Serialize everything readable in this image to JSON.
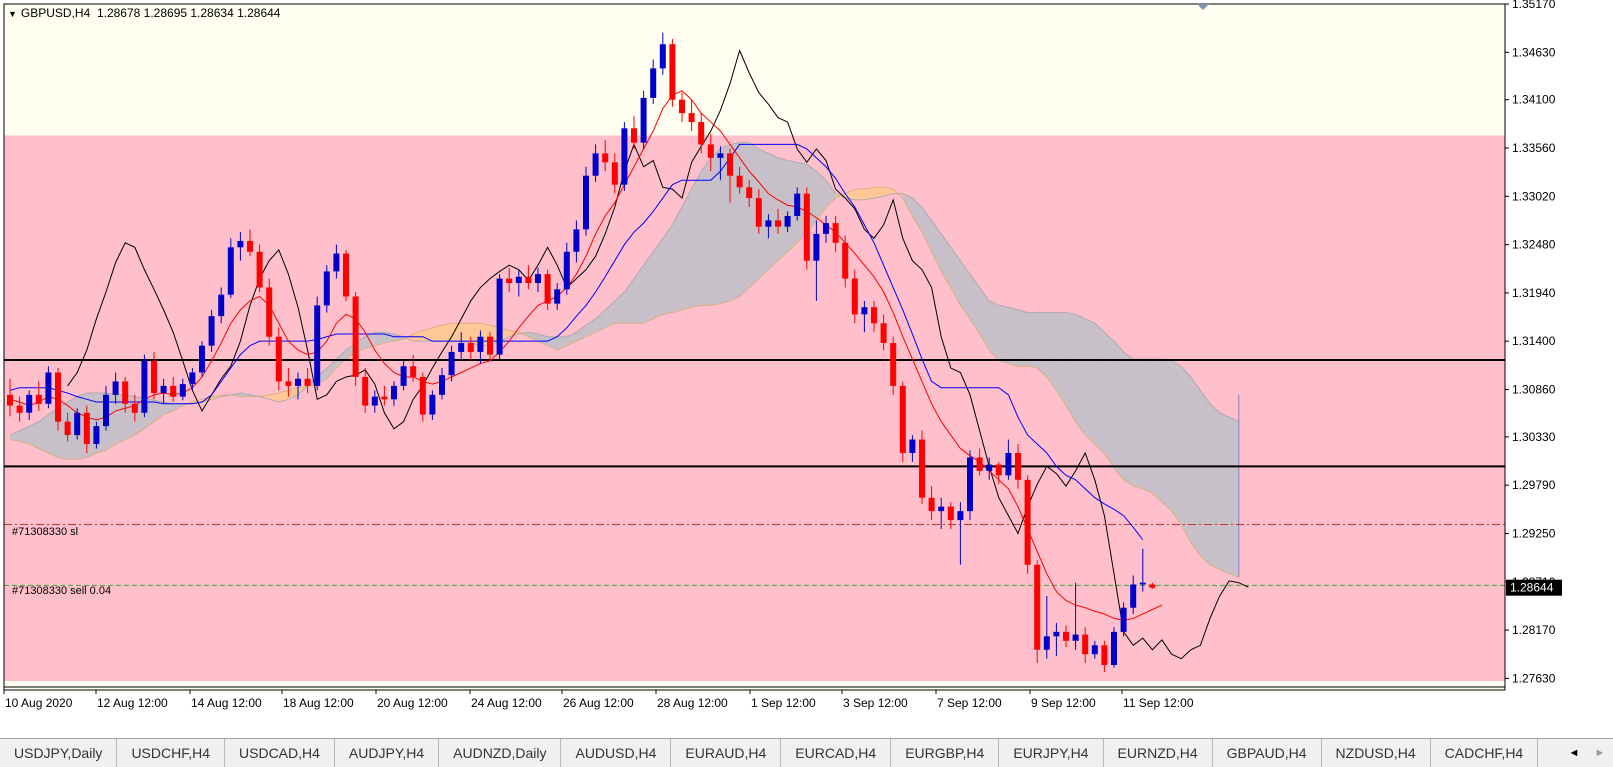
{
  "header": {
    "symbol": "GBPUSD,H4",
    "ohlc": "1.28678 1.28695 1.28634 1.28644"
  },
  "orders": {
    "sl_label": "#71308330 sl",
    "sell_label": "#71308330 sell 0.04"
  },
  "price_tag": "1.28644",
  "colors": {
    "background_top": "#fffef0",
    "background_zone": "#ffc0cb",
    "bull_candle": "#0000cd",
    "bear_candle": "#ff0000",
    "tenkan": "#ff0000",
    "kijun": "#0000ff",
    "chikou": "#000000",
    "kumo_bear": "#c8c0c8",
    "kumo_bull": "#ffc896"
  },
  "chart_data": {
    "type": "candlestick",
    "symbol": "GBPUSD",
    "timeframe": "H4",
    "ylim": [
      1.275,
      1.3517
    ],
    "y_ticks": [
      "1.35170",
      "1.34630",
      "1.34100",
      "1.33560",
      "1.33020",
      "1.32480",
      "1.31940",
      "1.31400",
      "1.30860",
      "1.30330",
      "1.29790",
      "1.29250",
      "1.28710",
      "1.28170",
      "1.27630"
    ],
    "x_ticks": [
      "10 Aug 2020",
      "12 Aug 12:00",
      "14 Aug 12:00",
      "18 Aug 12:00",
      "20 Aug 12:00",
      "24 Aug 12:00",
      "26 Aug 12:00",
      "28 Aug 12:00",
      "1 Sep 12:00",
      "3 Sep 12:00",
      "7 Sep 12:00",
      "9 Sep 12:00",
      "11 Sep 12:00"
    ],
    "zone": {
      "low": 1.276,
      "high": 1.337
    },
    "horizontal_lines": [
      {
        "name": "level-upper",
        "price": 1.3119,
        "style": "solid"
      },
      {
        "name": "level-lower",
        "price": 1.3,
        "style": "solid"
      },
      {
        "name": "stop-loss",
        "price": 1.2935,
        "style": "dash-dot"
      },
      {
        "name": "sell-entry",
        "price": 1.2867,
        "style": "dashed"
      }
    ],
    "close_price": 1.28644,
    "candles": [
      [
        1.308,
        1.3098,
        1.3056,
        1.3068
      ],
      [
        1.3068,
        1.3078,
        1.305,
        1.306
      ],
      [
        1.306,
        1.3085,
        1.3052,
        1.308
      ],
      [
        1.308,
        1.3095,
        1.3062,
        1.307
      ],
      [
        1.307,
        1.3112,
        1.3065,
        1.3105
      ],
      [
        1.3105,
        1.311,
        1.304,
        1.305
      ],
      [
        1.305,
        1.306,
        1.3028,
        1.3035
      ],
      [
        1.3035,
        1.3065,
        1.303,
        1.306
      ],
      [
        1.306,
        1.3068,
        1.3015,
        1.3025
      ],
      [
        1.3025,
        1.305,
        1.302,
        1.3045
      ],
      [
        1.3045,
        1.309,
        1.304,
        1.308
      ],
      [
        1.308,
        1.3105,
        1.307,
        1.3095
      ],
      [
        1.3095,
        1.31,
        1.306,
        1.307
      ],
      [
        1.307,
        1.308,
        1.305,
        1.306
      ],
      [
        1.306,
        1.3125,
        1.3055,
        1.3118
      ],
      [
        1.3118,
        1.3128,
        1.3075,
        1.3082
      ],
      [
        1.3082,
        1.3098,
        1.307,
        1.309
      ],
      [
        1.309,
        1.31,
        1.3072,
        1.3078
      ],
      [
        1.3078,
        1.3098,
        1.3074,
        1.3092
      ],
      [
        1.3092,
        1.311,
        1.3085,
        1.3105
      ],
      [
        1.3105,
        1.314,
        1.31,
        1.3135
      ],
      [
        1.3135,
        1.3175,
        1.3128,
        1.3168
      ],
      [
        1.3168,
        1.32,
        1.316,
        1.3192
      ],
      [
        1.3192,
        1.3255,
        1.3188,
        1.3245
      ],
      [
        1.3245,
        1.3262,
        1.323,
        1.3252
      ],
      [
        1.3252,
        1.3265,
        1.3235,
        1.324
      ],
      [
        1.324,
        1.3248,
        1.3195,
        1.32
      ],
      [
        1.32,
        1.321,
        1.3135,
        1.3145
      ],
      [
        1.3145,
        1.3155,
        1.3085,
        1.3095
      ],
      [
        1.3095,
        1.311,
        1.3078,
        1.309
      ],
      [
        1.309,
        1.3105,
        1.3075,
        1.3098
      ],
      [
        1.3098,
        1.311,
        1.3082,
        1.309
      ],
      [
        1.309,
        1.319,
        1.3085,
        1.318
      ],
      [
        1.318,
        1.3225,
        1.3172,
        1.3218
      ],
      [
        1.3218,
        1.3248,
        1.321,
        1.3238
      ],
      [
        1.3238,
        1.3242,
        1.3185,
        1.319
      ],
      [
        1.319,
        1.3195,
        1.309,
        1.31
      ],
      [
        1.31,
        1.311,
        1.306,
        1.3068
      ],
      [
        1.3068,
        1.3085,
        1.306,
        1.3078
      ],
      [
        1.3078,
        1.309,
        1.3068,
        1.3075
      ],
      [
        1.3075,
        1.3095,
        1.3068,
        1.309
      ],
      [
        1.309,
        1.312,
        1.3085,
        1.3112
      ],
      [
        1.3112,
        1.3125,
        1.3095,
        1.31
      ],
      [
        1.31,
        1.3105,
        1.305,
        1.3058
      ],
      [
        1.3058,
        1.3085,
        1.3052,
        1.308
      ],
      [
        1.308,
        1.311,
        1.3075,
        1.3102
      ],
      [
        1.3102,
        1.3135,
        1.3095,
        1.3128
      ],
      [
        1.3128,
        1.315,
        1.3118,
        1.3138
      ],
      [
        1.3138,
        1.3145,
        1.312,
        1.3128
      ],
      [
        1.3128,
        1.3152,
        1.3115,
        1.3145
      ],
      [
        1.3145,
        1.315,
        1.3118,
        1.3125
      ],
      [
        1.3125,
        1.3215,
        1.312,
        1.321
      ],
      [
        1.321,
        1.3222,
        1.3195,
        1.3205
      ],
      [
        1.3205,
        1.322,
        1.319,
        1.3212
      ],
      [
        1.3212,
        1.3225,
        1.3198,
        1.3205
      ],
      [
        1.3205,
        1.3222,
        1.3195,
        1.3215
      ],
      [
        1.3215,
        1.322,
        1.3175,
        1.3182
      ],
      [
        1.3182,
        1.3205,
        1.3175,
        1.3198
      ],
      [
        1.3198,
        1.325,
        1.3192,
        1.324
      ],
      [
        1.324,
        1.3275,
        1.3228,
        1.3265
      ],
      [
        1.3265,
        1.3335,
        1.3258,
        1.3325
      ],
      [
        1.3325,
        1.336,
        1.3318,
        1.335
      ],
      [
        1.335,
        1.3365,
        1.333,
        1.334
      ],
      [
        1.334,
        1.335,
        1.3305,
        1.3315
      ],
      [
        1.3315,
        1.3385,
        1.3308,
        1.3378
      ],
      [
        1.3378,
        1.3392,
        1.3355,
        1.3362
      ],
      [
        1.3362,
        1.342,
        1.3355,
        1.3412
      ],
      [
        1.3412,
        1.3455,
        1.3405,
        1.3445
      ],
      [
        1.3445,
        1.3485,
        1.3438,
        1.3472
      ],
      [
        1.3472,
        1.3478,
        1.3402,
        1.341
      ],
      [
        1.341,
        1.3418,
        1.3385,
        1.3395
      ],
      [
        1.3395,
        1.341,
        1.3375,
        1.3385
      ],
      [
        1.3385,
        1.3395,
        1.335,
        1.336
      ],
      [
        1.336,
        1.3372,
        1.333,
        1.3345
      ],
      [
        1.3345,
        1.3358,
        1.332,
        1.335
      ],
      [
        1.335,
        1.3355,
        1.3295,
        1.3325
      ],
      [
        1.3325,
        1.3335,
        1.3305,
        1.3312
      ],
      [
        1.3312,
        1.332,
        1.329,
        1.33
      ],
      [
        1.33,
        1.331,
        1.326,
        1.3268
      ],
      [
        1.3268,
        1.3282,
        1.3255,
        1.3275
      ],
      [
        1.3275,
        1.3288,
        1.326,
        1.3268
      ],
      [
        1.3268,
        1.3285,
        1.3262,
        1.328
      ],
      [
        1.328,
        1.3312,
        1.3275,
        1.3305
      ],
      [
        1.3305,
        1.3312,
        1.322,
        1.323
      ],
      [
        1.323,
        1.3275,
        1.3185,
        1.326
      ],
      [
        1.326,
        1.328,
        1.325,
        1.3272
      ],
      [
        1.3272,
        1.328,
        1.324,
        1.325
      ],
      [
        1.325,
        1.3258,
        1.32,
        1.321
      ],
      [
        1.321,
        1.322,
        1.316,
        1.317
      ],
      [
        1.317,
        1.3185,
        1.315,
        1.3178
      ],
      [
        1.3178,
        1.3185,
        1.315,
        1.316
      ],
      [
        1.316,
        1.317,
        1.313,
        1.3138
      ],
      [
        1.3138,
        1.3145,
        1.308,
        1.309
      ],
      [
        1.309,
        1.3095,
        1.3005,
        1.3015
      ],
      [
        1.3015,
        1.3035,
        1.3005,
        1.303
      ],
      [
        1.303,
        1.304,
        1.2958,
        1.2965
      ],
      [
        1.2965,
        1.2978,
        1.294,
        1.295
      ],
      [
        1.295,
        1.2965,
        1.293,
        1.2955
      ],
      [
        1.2955,
        1.296,
        1.293,
        1.294
      ],
      [
        1.294,
        1.296,
        1.289,
        1.295
      ],
      [
        1.295,
        1.3018,
        1.294,
        1.301
      ],
      [
        1.301,
        1.302,
        1.299,
        1.2995
      ],
      [
        1.2995,
        1.301,
        1.2985,
        1.3002
      ],
      [
        1.3002,
        1.3005,
        1.298,
        1.299
      ],
      [
        1.299,
        1.303,
        1.2985,
        1.3015
      ],
      [
        1.3015,
        1.3025,
        1.2975,
        1.2985
      ],
      [
        1.2985,
        1.299,
        1.288,
        1.289
      ],
      [
        1.289,
        1.2895,
        1.278,
        1.2795
      ],
      [
        1.2795,
        1.2855,
        1.2785,
        1.281
      ],
      [
        1.281,
        1.2825,
        1.2788,
        1.2815
      ],
      [
        1.2815,
        1.2822,
        1.2798,
        1.2805
      ],
      [
        1.2805,
        1.287,
        1.2795,
        1.2812
      ],
      [
        1.2812,
        1.282,
        1.278,
        1.279
      ],
      [
        1.279,
        1.2805,
        1.2785,
        1.28
      ],
      [
        1.28,
        1.2805,
        1.277,
        1.2778
      ],
      [
        1.2778,
        1.282,
        1.2775,
        1.2815
      ],
      [
        1.2815,
        1.2848,
        1.281,
        1.2842
      ],
      [
        1.2842,
        1.2878,
        1.2835,
        1.2868
      ],
      [
        1.2868,
        1.2908,
        1.286,
        1.287
      ],
      [
        1.2868,
        1.287,
        1.2863,
        1.28644
      ]
    ],
    "tenkan": [
      1.3075,
      1.3072,
      1.3068,
      1.3072,
      1.3078,
      1.3075,
      1.3068,
      1.306,
      1.3055,
      1.3052,
      1.3055,
      1.3062,
      1.3065,
      1.3068,
      1.3075,
      1.308,
      1.3082,
      1.308,
      1.3082,
      1.3088,
      1.31,
      1.3118,
      1.3138,
      1.316,
      1.3175,
      1.3185,
      1.319,
      1.318,
      1.316,
      1.314,
      1.313,
      1.3125,
      1.3128,
      1.314,
      1.316,
      1.317,
      1.3165,
      1.315,
      1.313,
      1.3115,
      1.3105,
      1.31,
      1.31,
      1.3095,
      1.3092,
      1.3095,
      1.31,
      1.3105,
      1.311,
      1.3115,
      1.3118,
      1.3128,
      1.314,
      1.3155,
      1.3168,
      1.318,
      1.3185,
      1.319,
      1.32,
      1.3215,
      1.3235,
      1.326,
      1.328,
      1.3295,
      1.3315,
      1.3335,
      1.3355,
      1.3375,
      1.34,
      1.3415,
      1.342,
      1.341,
      1.3395,
      1.3385,
      1.3375,
      1.336,
      1.3345,
      1.333,
      1.3318,
      1.3305,
      1.3298,
      1.3292,
      1.329,
      1.3285,
      1.3278,
      1.327,
      1.3262,
      1.325,
      1.3238,
      1.3225,
      1.3212,
      1.3195,
      1.3172,
      1.3145,
      1.312,
      1.3095,
      1.307,
      1.305,
      1.3035,
      1.302,
      1.3012,
      1.3005,
      1.2995,
      1.2985,
      1.2975,
      1.2955,
      1.293,
      1.2905,
      1.288,
      1.286,
      1.285,
      1.2845,
      1.2842,
      1.2838,
      1.2835,
      1.283,
      1.2828,
      1.283,
      1.2835,
      1.284,
      1.2845
    ],
    "kijun": [
      1.3085,
      1.3088,
      1.3088,
      1.3088,
      1.3088,
      1.3085,
      1.3082,
      1.3078,
      1.3075,
      1.3072,
      1.3072,
      1.3072,
      1.3072,
      1.3072,
      1.3072,
      1.3072,
      1.307,
      1.307,
      1.307,
      1.307,
      1.3072,
      1.308,
      1.3095,
      1.311,
      1.3125,
      1.3135,
      1.314,
      1.314,
      1.314,
      1.314,
      1.314,
      1.314,
      1.3142,
      1.3145,
      1.3148,
      1.3148,
      1.3148,
      1.3148,
      1.3148,
      1.3148,
      1.3145,
      1.3145,
      1.3145,
      1.3145,
      1.314,
      1.314,
      1.314,
      1.314,
      1.314,
      1.314,
      1.314,
      1.314,
      1.314,
      1.314,
      1.314,
      1.314,
      1.314,
      1.3145,
      1.3155,
      1.3168,
      1.318,
      1.3195,
      1.3212,
      1.323,
      1.3248,
      1.3262,
      1.3272,
      1.3285,
      1.33,
      1.3315,
      1.332,
      1.332,
      1.332,
      1.332,
      1.333,
      1.3345,
      1.336,
      1.336,
      1.336,
      1.336,
      1.336,
      1.336,
      1.336,
      1.3355,
      1.3345,
      1.3335,
      1.3322,
      1.3305,
      1.329,
      1.327,
      1.325,
      1.3225,
      1.32,
      1.3175,
      1.3148,
      1.312,
      1.3095,
      1.3088,
      1.3088,
      1.3088,
      1.3088,
      1.3088,
      1.3088,
      1.3088,
      1.308,
      1.3055,
      1.3035,
      1.3025,
      1.3015,
      1.3,
      1.299,
      1.2985,
      1.2975,
      1.2965,
      1.2958,
      1.2952,
      1.2945,
      1.2932,
      1.2918
    ],
    "chikou": [
      1.309,
      1.3105,
      1.313,
      1.3165,
      1.3195,
      1.3228,
      1.325,
      1.3245,
      1.322,
      1.3198,
      1.3175,
      1.315,
      1.3118,
      1.3085,
      1.3062,
      1.308,
      1.3098,
      1.3112,
      1.314,
      1.318,
      1.321,
      1.323,
      1.3242,
      1.3215,
      1.3178,
      1.313,
      1.3075,
      1.308,
      1.3095,
      1.31,
      1.3102,
      1.3108,
      1.3092,
      1.306,
      1.3042,
      1.305,
      1.3075,
      1.309,
      1.311,
      1.3128,
      1.3145,
      1.3165,
      1.3185,
      1.32,
      1.321,
      1.3218,
      1.3225,
      1.322,
      1.3208,
      1.3225,
      1.3245,
      1.3225,
      1.32,
      1.321,
      1.322,
      1.3235,
      1.326,
      1.329,
      1.333,
      1.336,
      1.3335,
      1.3342,
      1.3312,
      1.331,
      1.33,
      1.334,
      1.3358,
      1.3375,
      1.3398,
      1.3428,
      1.3465,
      1.344,
      1.3418,
      1.3405,
      1.339,
      1.3385,
      1.3355,
      1.334,
      1.3355,
      1.3342,
      1.331,
      1.33,
      1.3288,
      1.3265,
      1.3255,
      1.327,
      1.3298,
      1.3255,
      1.323,
      1.322,
      1.32,
      1.3145,
      1.311,
      1.3105,
      1.308,
      1.304,
      1.3,
      1.2965,
      1.2945,
      1.2925,
      1.2955,
      1.298,
      1.3,
      1.2992,
      1.2978,
      1.2995,
      1.3015,
      1.2985,
      1.2945,
      1.288,
      1.2815,
      1.28,
      1.2808,
      1.2795,
      1.2806,
      1.279,
      1.2785,
      1.2795,
      1.28,
      1.283,
      1.2855,
      1.2872,
      1.287,
      1.2865
    ],
    "span_a": [
      1.303,
      1.3028,
      1.3025,
      1.302,
      1.3015,
      1.301,
      1.3008,
      1.3008,
      1.301,
      1.3015,
      1.3018,
      1.3025,
      1.303,
      1.3035,
      1.3042,
      1.305,
      1.3058,
      1.3062,
      1.3068,
      1.3072,
      1.3075,
      1.3078,
      1.308,
      1.308,
      1.3078,
      1.3078,
      1.3078,
      1.308,
      1.3082,
      1.3085,
      1.3088,
      1.309,
      1.3092,
      1.3098,
      1.311,
      1.312,
      1.3128,
      1.3132,
      1.3135,
      1.3138,
      1.314,
      1.3142,
      1.3148,
      1.3152,
      1.3155,
      1.3158,
      1.316,
      1.316,
      1.316,
      1.316,
      1.3158,
      1.3155,
      1.3152,
      1.315,
      1.3145,
      1.314,
      1.3135,
      1.313,
      1.3135,
      1.314,
      1.3145,
      1.315,
      1.3155,
      1.316,
      1.316,
      1.316,
      1.316,
      1.3165,
      1.317,
      1.3172,
      1.3175,
      1.3178,
      1.318,
      1.318,
      1.3182,
      1.3185,
      1.319,
      1.32,
      1.321,
      1.322,
      1.323,
      1.324,
      1.325,
      1.3262,
      1.3275,
      1.329,
      1.33,
      1.3305,
      1.331,
      1.331,
      1.3312,
      1.3312,
      1.331,
      1.33,
      1.328,
      1.3262,
      1.324,
      1.3218,
      1.32,
      1.318,
      1.3165,
      1.3148,
      1.313,
      1.3118,
      1.3115,
      1.3112,
      1.3112,
      1.311,
      1.31,
      1.3085,
      1.3068,
      1.305,
      1.3035,
      1.3025,
      1.3015,
      1.2998,
      1.2985,
      1.2978,
      1.2975,
      1.297,
      1.296,
      1.295,
      1.2935,
      1.2915,
      1.29,
      1.289,
      1.2885,
      1.288,
      1.2876
    ],
    "span_b": [
      1.3035,
      1.304,
      1.3045,
      1.305,
      1.3058,
      1.3065,
      1.3072,
      1.3078,
      1.3082,
      1.3082,
      1.3082,
      1.308,
      1.308,
      1.3078,
      1.3076,
      1.3074,
      1.3072,
      1.307,
      1.307,
      1.307,
      1.3072,
      1.3075,
      1.3078,
      1.308,
      1.3082,
      1.308,
      1.3078,
      1.3075,
      1.3072,
      1.3075,
      1.308,
      1.309,
      1.31,
      1.311,
      1.312,
      1.313,
      1.3138,
      1.3145,
      1.315,
      1.315,
      1.3148,
      1.3145,
      1.314,
      1.314,
      1.314,
      1.314,
      1.314,
      1.314,
      1.3138,
      1.3135,
      1.3135,
      1.314,
      1.3145,
      1.3148,
      1.315,
      1.3148,
      1.3145,
      1.3145,
      1.3145,
      1.315,
      1.3158,
      1.3165,
      1.3175,
      1.3185,
      1.3195,
      1.321,
      1.3225,
      1.324,
      1.3255,
      1.327,
      1.329,
      1.331,
      1.333,
      1.3345,
      1.3355,
      1.336,
      1.3362,
      1.3362,
      1.3355,
      1.335,
      1.3345,
      1.3342,
      1.334,
      1.3338,
      1.333,
      1.332,
      1.3305,
      1.33,
      1.3298,
      1.3298,
      1.33,
      1.3302,
      1.3305,
      1.3305,
      1.33,
      1.329,
      1.3275,
      1.326,
      1.3245,
      1.323,
      1.3215,
      1.32,
      1.3185,
      1.318,
      1.3178,
      1.3175,
      1.3172,
      1.3172,
      1.3172,
      1.3172,
      1.3172,
      1.317,
      1.3165,
      1.316,
      1.315,
      1.314,
      1.3128,
      1.312,
      1.312,
      1.312,
      1.312,
      1.3118,
      1.3112,
      1.31,
      1.3085,
      1.307,
      1.306,
      1.3055,
      1.305
    ]
  },
  "tabs": [
    "USDJPY,Daily",
    "USDCHF,H4",
    "USDCAD,H4",
    "AUDJPY,H4",
    "AUDNZD,Daily",
    "AUDUSD,H4",
    "EURAUD,H4",
    "EURCAD,H4",
    "EURGBP,H4",
    "EURJPY,H4",
    "EURNZD,H4",
    "GBPAUD,H4",
    "NZDUSD,H4",
    "CADCHF,H4"
  ],
  "nav": {
    "left": "◄",
    "right": "►"
  }
}
